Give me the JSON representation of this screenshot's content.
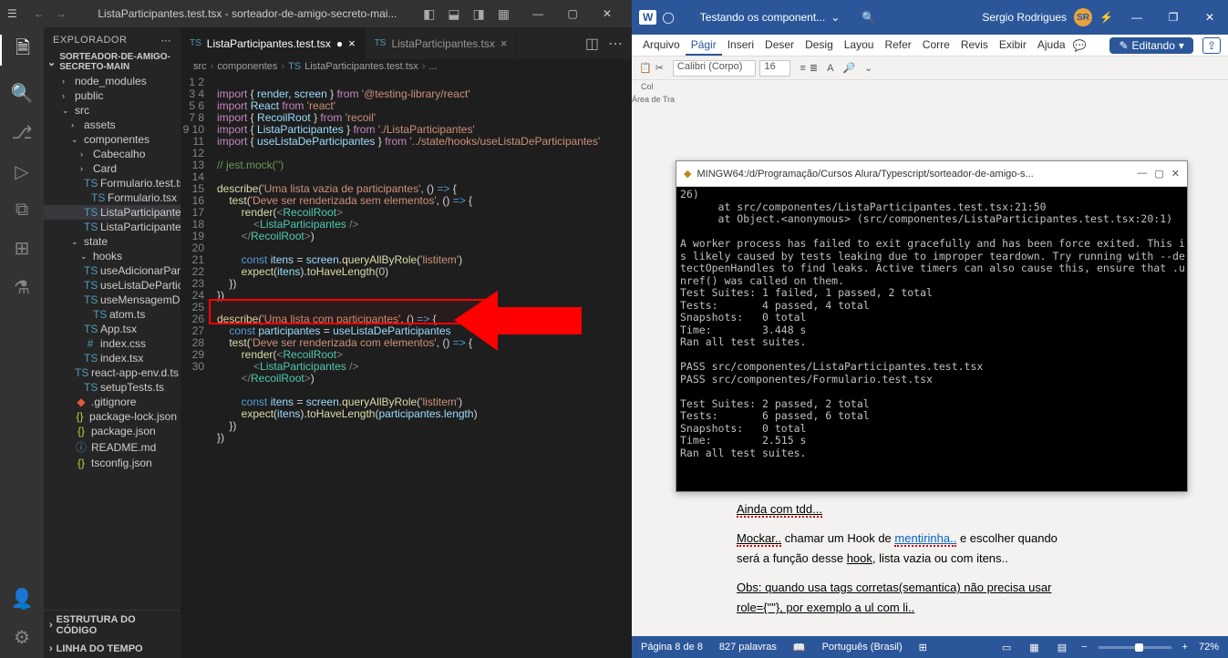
{
  "vscode": {
    "title": "ListaParticipantes.test.tsx - sorteador-de-amigo-secreto-mai...",
    "explorer_label": "EXPLORADOR",
    "project_name": "SORTEADOR-DE-AMIGO-SECRETO-MAIN",
    "tree": [
      {
        "label": "node_modules",
        "type": "folder",
        "indent": 1,
        "chev": "›"
      },
      {
        "label": "public",
        "type": "folder",
        "indent": 1,
        "chev": "›"
      },
      {
        "label": "src",
        "type": "folder",
        "indent": 1,
        "chev": "⌄"
      },
      {
        "label": "assets",
        "type": "folder",
        "indent": 2,
        "chev": "›"
      },
      {
        "label": "componentes",
        "type": "folder",
        "indent": 2,
        "chev": "⌄"
      },
      {
        "label": "Cabecalho",
        "type": "folder",
        "indent": 3,
        "chev": "›"
      },
      {
        "label": "Card",
        "type": "folder",
        "indent": 3,
        "chev": "›"
      },
      {
        "label": "Formulario.test.tsx",
        "type": "ts",
        "indent": 3
      },
      {
        "label": "Formulario.tsx",
        "type": "ts",
        "indent": 3
      },
      {
        "label": "ListaParticipantes.test.tsx",
        "type": "ts",
        "indent": 3,
        "selected": true
      },
      {
        "label": "ListaParticipantes.tsx",
        "type": "ts",
        "indent": 3
      },
      {
        "label": "state",
        "type": "folder",
        "indent": 2,
        "chev": "⌄"
      },
      {
        "label": "hooks",
        "type": "folder",
        "indent": 3,
        "chev": "⌄"
      },
      {
        "label": "useAdicionarParticipante.ts",
        "type": "ts",
        "indent": 3
      },
      {
        "label": "useListaDeParticipantes.tsx",
        "type": "ts",
        "indent": 3
      },
      {
        "label": "useMensagemDeErro.ts",
        "type": "ts",
        "indent": 3
      },
      {
        "label": "atom.ts",
        "type": "ts",
        "indent": 3
      },
      {
        "label": "App.tsx",
        "type": "ts",
        "indent": 2
      },
      {
        "label": "index.css",
        "type": "css",
        "indent": 2
      },
      {
        "label": "index.tsx",
        "type": "ts",
        "indent": 2
      },
      {
        "label": "react-app-env.d.ts",
        "type": "ts",
        "indent": 2
      },
      {
        "label": "setupTests.ts",
        "type": "ts",
        "indent": 2
      },
      {
        "label": ".gitignore",
        "type": "git",
        "indent": 1
      },
      {
        "label": "package-lock.json",
        "type": "json",
        "indent": 1
      },
      {
        "label": "package.json",
        "type": "json",
        "indent": 1
      },
      {
        "label": "README.md",
        "type": "md",
        "indent": 1
      },
      {
        "label": "tsconfig.json",
        "type": "json",
        "indent": 1
      }
    ],
    "outline_label": "ESTRUTURA DO CÓDIGO",
    "timeline_label": "LINHA DO TEMPO",
    "tabs": [
      {
        "label": "ListaParticipantes.test.tsx",
        "active": true,
        "modified": true
      },
      {
        "label": "ListaParticipantes.tsx",
        "active": false
      }
    ],
    "breadcrumb": [
      "src",
      "componentes",
      "ListaParticipantes.test.tsx",
      "..."
    ],
    "line_count": 30
  },
  "word": {
    "doc_title": "Testando os component...",
    "user_name": "Sergio Rodrigues",
    "user_initials": "SR",
    "ribbon_tabs": [
      "Arquivo",
      "Págir",
      "Inseri",
      "Deser",
      "Desig",
      "Layou",
      "Refer",
      "Corre",
      "Revis",
      "Exibir",
      "Ajuda"
    ],
    "active_tab_index": 1,
    "edit_label": "Editando",
    "font_name": "Calibri (Corpo)",
    "font_size": "16",
    "clipboard_label": "Col",
    "area_label": "Área de Tra",
    "doc_body": {
      "l1_a": "Ainda com tdd...",
      "l2_a": "Mockar..",
      "l2_b": " chamar um Hook de ",
      "l2_c": "mentirinha..",
      "l2_d": " e escolher quando",
      "l3_a": "será a função desse ",
      "l3_b": "hook",
      "l3_c": ", lista vazia ou com itens..",
      "l4_a": "Obs: quando usa tags corretas(semantica) não precisa usar",
      "l5_a": "role={\"\"}, por exemplo a ul com li.."
    },
    "statusbar": {
      "page": "Página 8 de 8",
      "words": "827 palavras",
      "lang": "Português (Brasil)",
      "zoom": "72%"
    }
  },
  "terminal": {
    "title": "MINGW64:/d/Programação/Cursos Alura/Typescript/sorteador-de-amigo-s...",
    "lines": [
      "26)",
      "      at src/componentes/ListaParticipantes.test.tsx:21:50",
      "      at Object.<anonymous> (src/componentes/ListaParticipantes.test.tsx:20:1)",
      "",
      "A worker process has failed to exit gracefully and has been force exited. This i",
      "s likely caused by tests leaking due to improper teardown. Try running with --de",
      "tectOpenHandles to find leaks. Active timers can also cause this, ensure that .u",
      "nref() was called on them.",
      "Test Suites: 1 failed, 1 passed, 2 total",
      "Tests:       4 passed, 4 total",
      "Snapshots:   0 total",
      "Time:        3.448 s",
      "Ran all test suites.",
      "",
      "PASS src/componentes/ListaParticipantes.test.tsx",
      "PASS src/componentes/Formulario.test.tsx",
      "",
      "Test Suites: 2 passed, 2 total",
      "Tests:       6 passed, 6 total",
      "Snapshots:   0 total",
      "Time:        2.515 s",
      "Ran all test suites."
    ]
  }
}
